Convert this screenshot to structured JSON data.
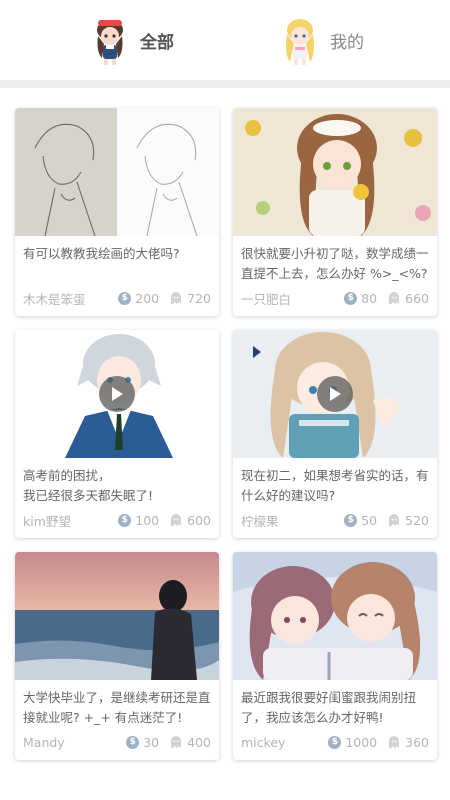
{
  "tabs": [
    {
      "label": "全部",
      "active": true
    },
    {
      "label": "我的",
      "active": false
    }
  ],
  "posts": [
    {
      "title": "有可以教教我绘画的大佬吗?",
      "author": "木木是笨蛋",
      "coins": "200",
      "views": "720",
      "video": false,
      "thumb": "sketch-drawing"
    },
    {
      "title": "很快就要小升初了哒，数学成绩一直提不上去，怎么办好 %>_<%?",
      "author": "一只肥白",
      "coins": "80",
      "views": "660",
      "video": false,
      "thumb": "anime-girl-flowers"
    },
    {
      "title": "高考前的困扰，\n我已经很多天都失眠了!",
      "author": "kim野望",
      "coins": "100",
      "views": "600",
      "video": true,
      "thumb": "anime-boy-silver-hair"
    },
    {
      "title": "现在初二，如果想考省实的话，有什么好的建议吗?",
      "author": "柠檬果",
      "coins": "50",
      "views": "520",
      "video": true,
      "thumb": "anime-girl-scarf"
    },
    {
      "title": "大学快毕业了，是继续考研还是直接就业呢?  +_+ 有点迷茫了!",
      "author": "Mandy",
      "coins": "30",
      "views": "400",
      "video": false,
      "thumb": "girl-at-beach-sunset"
    },
    {
      "title": "最近跟我很要好闺蜜跟我闹别扭了，我应该怎么办才好鸭! Σ(●◎●)",
      "author": "mickey",
      "coins": "1000",
      "views": "360",
      "video": false,
      "thumb": "two-anime-girls-umbrella"
    }
  ],
  "colors": {
    "accent_text": "#555555",
    "muted_text": "#b5b5b5",
    "coin": "#9fb2c4",
    "divider": "#eeeeee"
  },
  "icons": {
    "coin": "coin-icon",
    "views": "ghost-icon",
    "play": "play-icon"
  }
}
